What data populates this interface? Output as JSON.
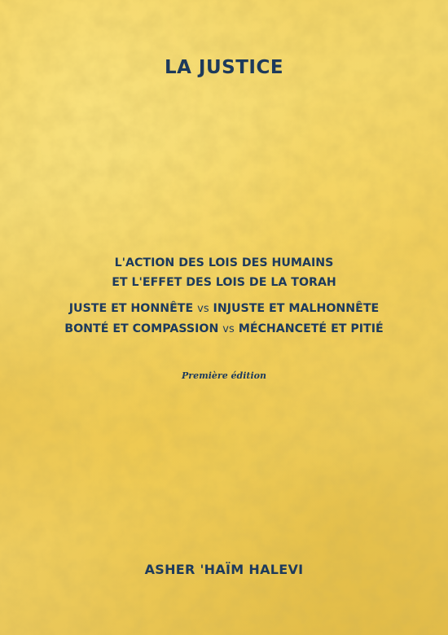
{
  "cover": {
    "title": "LA JUSTICE",
    "subtitle": {
      "line1": "L'ACTION DES LOIS DES HUMAINS",
      "line2": "ET L'EFFET DES LOIS DE LA TORAH"
    },
    "themes": {
      "line1_left": "JUSTE ET HONNÊTE",
      "line1_vs": "vs",
      "line1_right": "INJUSTE ET MALHONNÊTE",
      "line2_left": "BONTÉ ET COMPASSION",
      "line2_vs": "vs",
      "line2_right": "MÉCHANCETÉ ET PITIÉ"
    },
    "edition": "Première édition",
    "author": "ASHER 'HAÏM HALEVI"
  },
  "colors": {
    "text": "#1d3a5c",
    "background_gold": "#ecc95c"
  }
}
